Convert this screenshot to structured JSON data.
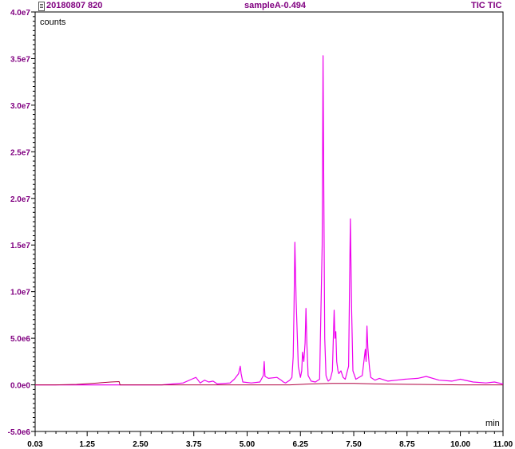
{
  "header": {
    "file_label": "20180807 820",
    "sample_label": "sampleA-0.494",
    "trace_label": "TIC TIC"
  },
  "chart_data": {
    "type": "line",
    "title": "",
    "xlabel": "min",
    "ylabel": "counts",
    "xlim": [
      0.03,
      11.0
    ],
    "ylim": [
      -5000000.0,
      40000000.0
    ],
    "x_ticks": [
      "0.03",
      "1.25",
      "2.50",
      "3.75",
      "5.00",
      "6.25",
      "7.50",
      "8.75",
      "10.00",
      "11.00"
    ],
    "x_tick_values": [
      0.03,
      1.25,
      2.5,
      3.75,
      5.0,
      6.25,
      7.5,
      8.75,
      10.0,
      11.0
    ],
    "y_ticks": [
      "4.0e7",
      "3.5e7",
      "3.0e7",
      "2.5e7",
      "2.0e7",
      "1.5e7",
      "1.0e7",
      "5.0e6",
      "0.0e0",
      "-5.0e6"
    ],
    "y_tick_values": [
      40000000.0,
      35000000.0,
      30000000.0,
      25000000.0,
      20000000.0,
      15000000.0,
      10000000.0,
      5000000.0,
      0,
      -5000000.0
    ],
    "colors": {
      "trace": "#ee00ee",
      "baseline": "#b00040",
      "frame": "#000000",
      "axis_text": "#800080"
    },
    "series": [
      {
        "color": "#ee00ee",
        "x": [
          0.03,
          1.0,
          1.8,
          2.0,
          2.05,
          3.0,
          3.5,
          3.7,
          3.8,
          3.9,
          4.0,
          4.1,
          4.2,
          4.3,
          4.6,
          4.7,
          4.8,
          4.84,
          4.86,
          4.9,
          5.1,
          5.3,
          5.38,
          5.4,
          5.42,
          5.5,
          5.7,
          5.8,
          5.85,
          5.9,
          6.0,
          6.05,
          6.08,
          6.1,
          6.12,
          6.15,
          6.2,
          6.25,
          6.28,
          6.3,
          6.33,
          6.36,
          6.38,
          6.4,
          6.43,
          6.5,
          6.6,
          6.7,
          6.74,
          6.76,
          6.78,
          6.8,
          6.82,
          6.85,
          6.88,
          6.9,
          6.95,
          7.0,
          7.04,
          7.06,
          7.08,
          7.1,
          7.13,
          7.15,
          7.2,
          7.25,
          7.3,
          7.38,
          7.42,
          7.45,
          7.48,
          7.55,
          7.7,
          7.77,
          7.79,
          7.81,
          7.83,
          7.85,
          7.87,
          7.9,
          8.0,
          8.1,
          8.3,
          8.5,
          8.7,
          9.0,
          9.2,
          9.5,
          9.8,
          10.0,
          10.3,
          10.6,
          10.8,
          11.0
        ],
        "y": [
          0,
          0,
          0,
          0,
          0,
          0,
          200000,
          600000,
          800000,
          200000,
          500000,
          300000,
          400000,
          100000,
          200000,
          600000,
          1200000,
          2000000,
          1200000,
          300000,
          200000,
          300000,
          1000000,
          2500000,
          900000,
          700000,
          800000,
          500000,
          300000,
          200000,
          500000,
          800000,
          3000000,
          8000000,
          15300000,
          9000000,
          2000000,
          800000,
          1500000,
          3500000,
          2500000,
          4500000,
          8200000,
          4500000,
          1000000,
          400000,
          300000,
          600000,
          10000000,
          15000000,
          35300000,
          20000000,
          5000000,
          1000000,
          600000,
          400000,
          600000,
          1500000,
          8000000,
          5000000,
          5700000,
          2500000,
          1500000,
          1200000,
          1500000,
          800000,
          600000,
          2000000,
          17800000,
          8000000,
          1500000,
          600000,
          1000000,
          3800000,
          2500000,
          6300000,
          4000000,
          2900000,
          1800000,
          800000,
          500000,
          700000,
          400000,
          500000,
          600000,
          700000,
          900000,
          500000,
          400000,
          600000,
          300000,
          200000,
          300000,
          100000
        ]
      },
      {
        "color": "#b00040",
        "x": [
          0.03,
          0.5,
          1.0,
          1.5,
          1.8,
          2.0,
          2.02,
          2.5,
          3.0,
          5.0,
          6.0,
          6.5,
          7.0,
          7.5,
          8.0,
          9.0,
          10.0,
          11.0
        ],
        "y": [
          0,
          0,
          50000,
          200000,
          300000,
          350000,
          0,
          0,
          0,
          0,
          0,
          100000,
          150000,
          150000,
          100000,
          50000,
          0,
          0
        ]
      }
    ]
  }
}
